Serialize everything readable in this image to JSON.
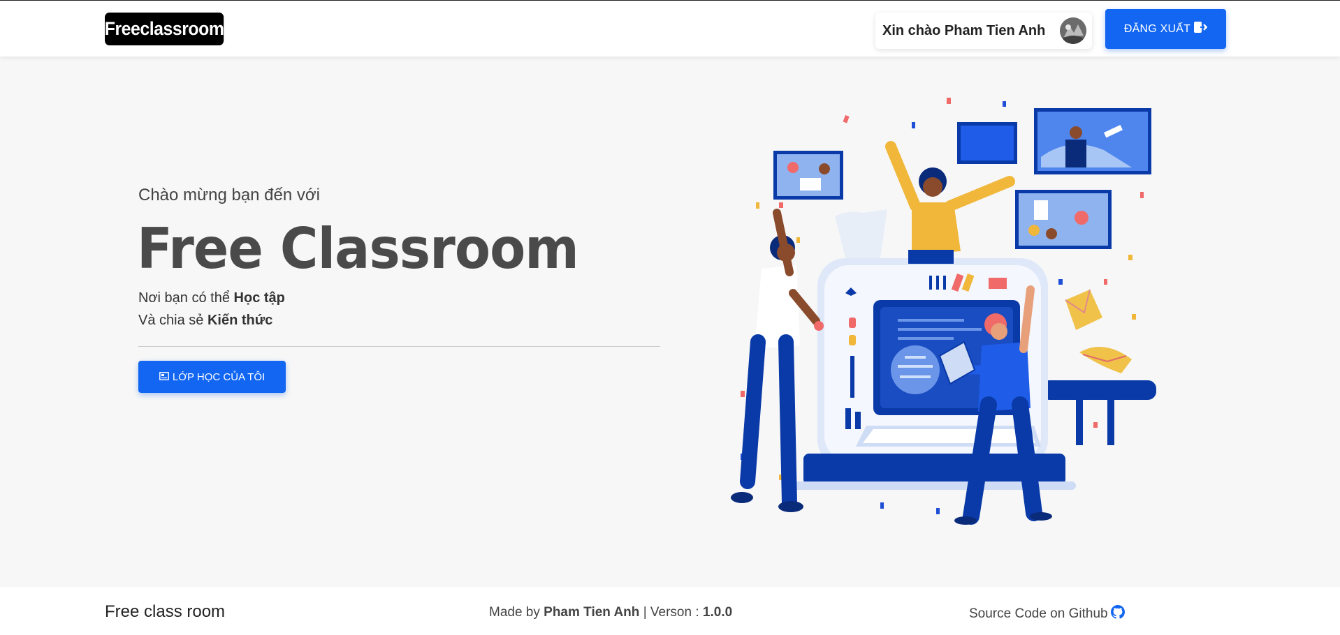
{
  "header": {
    "logo": "Freeclassroom",
    "greeting": "Xin chào Pham Tien Anh",
    "logout_label": "ĐĂNG XUẤT"
  },
  "hero": {
    "subtitle": "Chào mừng bạn đến với",
    "title": "Free Classroom",
    "line1_prefix": "Nơi bạn có thể",
    "line1_bold": "Học tập",
    "line2_prefix": "Và chia sẻ",
    "line2_bold": "Kiến thức",
    "button_label": "LỚP HỌC CỦA TÔI"
  },
  "footer": {
    "left": "Free class room",
    "made_by_prefix": "Made by",
    "author": "Pham Tien Anh",
    "version_prefix": "| Verson :",
    "version": "1.0.0",
    "source_label": "Source Code on Github"
  },
  "colors": {
    "primary": "#1266f1",
    "background": "#f7f7f7",
    "illustration_blue": "#0a3aa8"
  },
  "icons": [
    "avatar-image",
    "logout-icon",
    "classroom-icon",
    "github-icon"
  ]
}
